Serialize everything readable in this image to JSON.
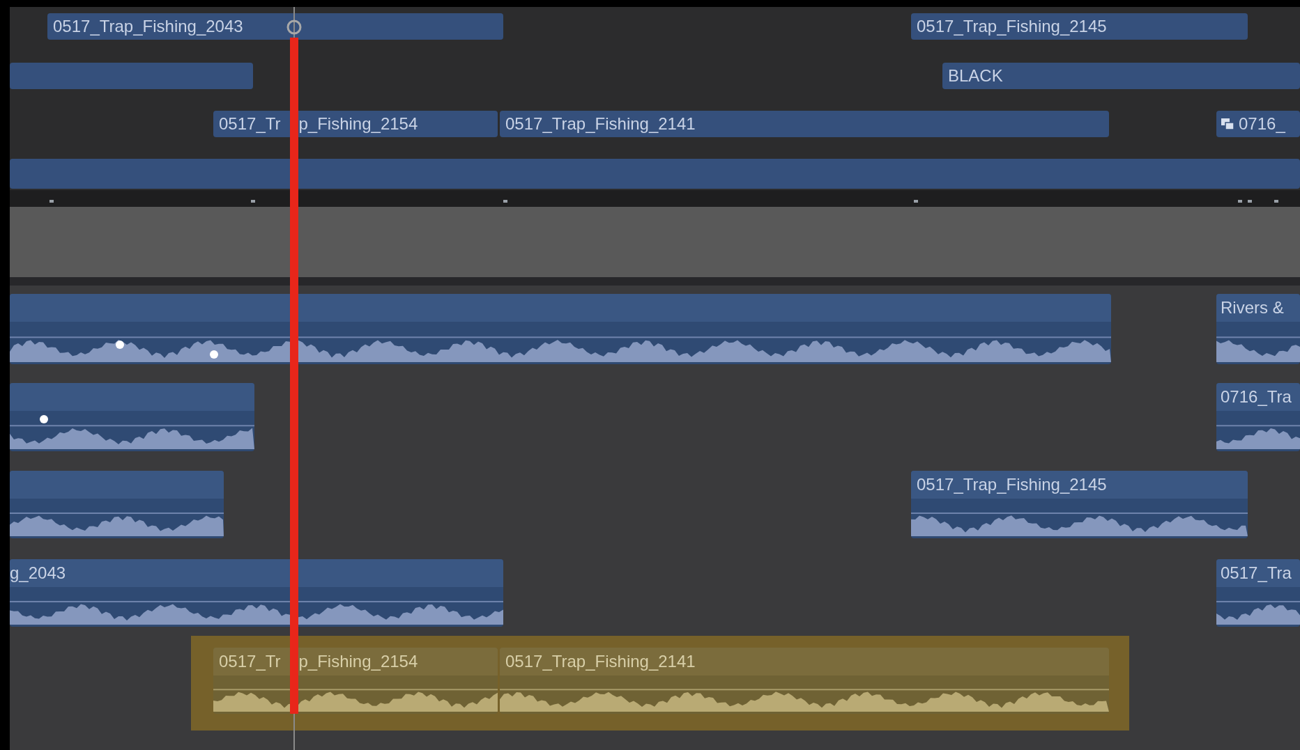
{
  "video_lanes": [
    {
      "clips": [
        {
          "kind": "clip",
          "label": "0517_Trap_Fishing_2043"
        },
        {
          "kind": "clip",
          "label": "0517_Trap_Fishing_2145"
        }
      ]
    },
    {
      "clips": [
        {
          "kind": "clip"
        },
        {
          "kind": "clip",
          "label": "BLACK"
        }
      ]
    },
    {
      "clips": [
        {
          "kind": "clip",
          "label_parts": [
            "0517_Tr",
            "p_Fishing_2154"
          ]
        },
        {
          "kind": "clip",
          "label": "0517_Trap_Fishing_2141"
        },
        {
          "kind": "compound",
          "label": "0716_"
        }
      ]
    },
    {
      "clips": [
        {
          "kind": "clip"
        }
      ]
    }
  ],
  "audio_lanes": [
    {
      "selected": false,
      "clips": [
        {
          "kind": "audio"
        },
        {
          "kind": "audio",
          "label": "Rivers &"
        }
      ]
    },
    {
      "selected": false,
      "clips": [
        {
          "kind": "audio"
        },
        {
          "kind": "audio",
          "label": "0716_Tra"
        }
      ]
    },
    {
      "selected": false,
      "clips": [
        {
          "kind": "audio"
        },
        {
          "kind": "audio",
          "label": "0517_Trap_Fishing_2145"
        }
      ]
    },
    {
      "selected": false,
      "clips": [
        {
          "kind": "audio",
          "label": "g_2043"
        },
        {
          "kind": "audio",
          "label": "0517_Tra"
        }
      ]
    },
    {
      "selected": true,
      "clips": [
        {
          "kind": "audio",
          "label_parts": [
            "0517_Tr",
            "p_Fishing_2154"
          ]
        },
        {
          "kind": "audio",
          "label": "0517_Trap_Fishing_2141"
        }
      ]
    }
  ]
}
